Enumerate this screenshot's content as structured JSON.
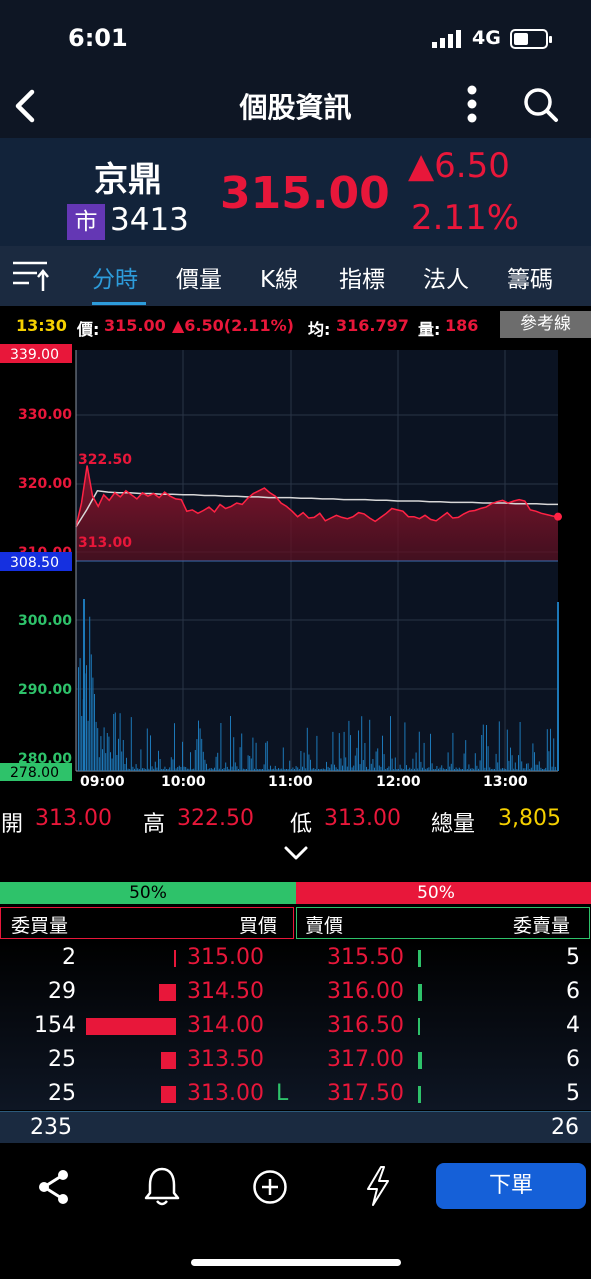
{
  "status": {
    "time": "6:01",
    "network": "4G"
  },
  "nav": {
    "title": "個股資訊"
  },
  "stock": {
    "name": "京鼎",
    "market_badge": "市",
    "code": "3413",
    "price": "315.00",
    "change": "▲6.50",
    "change_pct": "2.11%"
  },
  "tabs": [
    "分時",
    "價量",
    "K線",
    "指標",
    "法人",
    "籌碼"
  ],
  "info": {
    "time": "13:30",
    "price_label": "價:",
    "price": "315.00",
    "change": "▲6.50(2.11%)",
    "avg_label": "均:",
    "avg": "316.797",
    "vol_label": "量:",
    "vol": "186",
    "ref_button": "參考線"
  },
  "chart_data": {
    "type": "line",
    "price_axis": {
      "top_label": "339.00",
      "bottom_label": "308.50",
      "ticks": [
        "330.00",
        "320.00",
        "310.00"
      ],
      "range": [
        308.5,
        339.0
      ]
    },
    "volume_axis": {
      "ticks": [
        "300.00",
        "290.00",
        "280.00"
      ],
      "bottom_label": "278.00"
    },
    "x_ticks": [
      "09:00",
      "10:00",
      "11:00",
      "12:00",
      "13:00"
    ],
    "annotations": {
      "high": "322.50",
      "low": "313.00"
    },
    "series": [
      {
        "values": [
          313.5,
          317.0,
          322.5,
          318.0,
          316.5,
          318.2,
          317.4,
          318.5,
          317.9,
          318.8,
          318.2,
          317.6,
          318.5,
          318.0,
          318.4,
          317.8,
          318.6,
          318.0,
          317.6,
          317.5,
          315.8,
          316.0,
          315.5,
          315.9,
          316.4,
          315.7,
          316.8,
          316.2,
          316.5,
          317.0,
          316.8,
          317.7,
          318.4,
          318.8,
          319.2,
          318.5,
          318.0,
          317.0,
          316.5,
          315.8,
          315.0,
          315.6,
          314.8,
          314.9,
          315.5,
          314.4,
          314.8,
          315.2,
          314.9,
          314.7,
          315.0,
          315.6,
          315.4,
          314.8,
          314.3,
          314.9,
          315.5,
          316.2,
          316.0,
          315.8,
          315.0,
          315.0,
          314.7,
          315.2,
          314.6,
          314.4,
          315.0,
          315.6,
          314.8,
          314.9,
          315.4,
          315.8,
          315.9,
          316.2,
          316.4,
          316.9,
          317.2,
          317.4,
          317.0,
          317.3,
          317.5,
          317.3,
          316.0,
          315.8,
          315.5,
          315.3,
          315.1,
          315.0
        ]
      },
      {
        "values": [
          313.5,
          316.0,
          318.8,
          318.6,
          318.5,
          318.5,
          318.4,
          318.4,
          318.3,
          318.3,
          318.2,
          318.2,
          318.1,
          318.1,
          318.0,
          318.0,
          317.9,
          317.9,
          317.8,
          317.8,
          317.8,
          317.7,
          317.7,
          317.6,
          317.6,
          317.5,
          317.5,
          317.5,
          317.4,
          317.4,
          317.3,
          317.3,
          317.3,
          317.2,
          317.2,
          317.1,
          317.1,
          317.1,
          317.0,
          317.0,
          317.0,
          316.9,
          316.9,
          316.9,
          316.8,
          316.8
        ]
      }
    ]
  },
  "ohlc": {
    "open_label": "開",
    "open": "313.00",
    "high_label": "高",
    "high": "322.50",
    "low_label": "低",
    "low": "313.00",
    "vol_label": "總量",
    "volume": "3,805"
  },
  "orderbook": {
    "bid_ratio": "50%",
    "ask_ratio": "50%",
    "headers": {
      "bid_qty": "委買量",
      "bid_price": "買價",
      "ask_price": "賣價",
      "ask_qty": "委賣量"
    },
    "rows": [
      {
        "bid_qty": "2",
        "bid_price": "315.00",
        "ask_price": "315.50",
        "ask_qty": "5",
        "bid_bar": 2,
        "ask_bar": 5
      },
      {
        "bid_qty": "29",
        "bid_price": "314.50",
        "ask_price": "316.00",
        "ask_qty": "6",
        "bid_bar": 29,
        "ask_bar": 6
      },
      {
        "bid_qty": "154",
        "bid_price": "314.00",
        "ask_price": "316.50",
        "ask_qty": "4",
        "bid_bar": 154,
        "ask_bar": 4
      },
      {
        "bid_qty": "25",
        "bid_price": "313.50",
        "ask_price": "317.00",
        "ask_qty": "6",
        "bid_bar": 25,
        "ask_bar": 6
      },
      {
        "bid_qty": "25",
        "bid_price": "313.00",
        "ask_price": "317.50",
        "ask_qty": "5",
        "bid_bar": 25,
        "ask_bar": 5,
        "limit_mark": "L"
      }
    ],
    "bid_total": "235",
    "ask_total": "26"
  },
  "bottom": {
    "order_button": "下單"
  },
  "colors": {
    "up": "#e8173a",
    "down": "#2ec26a",
    "accent": "#2d9cdb",
    "order_btn": "#1560d8"
  }
}
